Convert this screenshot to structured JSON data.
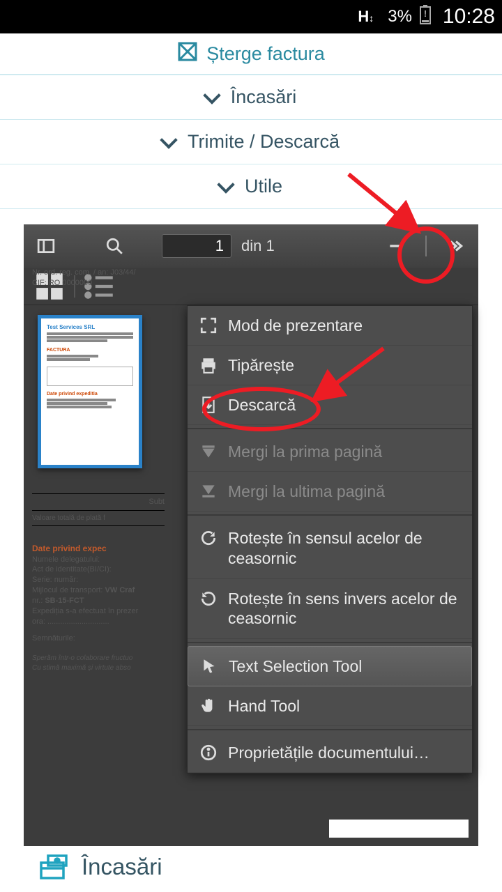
{
  "status_bar": {
    "battery": "3%",
    "time": "10:28"
  },
  "top_action": {
    "label": "Șterge factura"
  },
  "accordions": [
    {
      "label": "Încasări"
    },
    {
      "label": "Trimite / Descarcă"
    },
    {
      "label": "Utile"
    }
  ],
  "pdf_toolbar": {
    "page_input": "1",
    "page_total": "din 1"
  },
  "pdf_menu": {
    "presentation": "Mod de prezentare",
    "print": "Tipărește",
    "download": "Descarcă",
    "first_page": "Mergi la prima pagină",
    "last_page": "Mergi la ultima pagină",
    "rotate_cw": "Rotește în sensul acelor de ceasornic",
    "rotate_ccw": "Rotește în sens invers acelor de ceasornic",
    "text_tool": "Text Selection Tool",
    "hand_tool": "Hand Tool",
    "properties": "Proprietățile documentului…"
  },
  "thumbnail": {
    "company": "Test Services SRL",
    "section": "FACTURA",
    "shipping": "Date privind expeditia"
  },
  "bg_doc": {
    "reg_line": "Nr. ord. reg. com. / an: J03/44/",
    "cif_line": "CIF: RO 0000000",
    "subtotal": "Subt",
    "total": "Valoare totală de plată f",
    "shipping_header": "Date privind expec",
    "line1": "Numele delegatului: ",
    "line2": "Act de identitate(BI/CI): ",
    "line3": "Serie:          număr: ",
    "line4a": "Mijlocul de transport: ",
    "line4b": "VW Craf",
    "line5a": "nr.: ",
    "line5b": "SB-15-FCT",
    "line6": "Expediția s-a efectuat în prezer",
    "line7": "ora: .............................",
    "sig": "Semnăturile:",
    "note1": "Sperăm într-o colaborare fructuo",
    "note2": "Cu stimă maximă și virtute abso"
  },
  "bottom_section": {
    "label": "Încasări"
  }
}
